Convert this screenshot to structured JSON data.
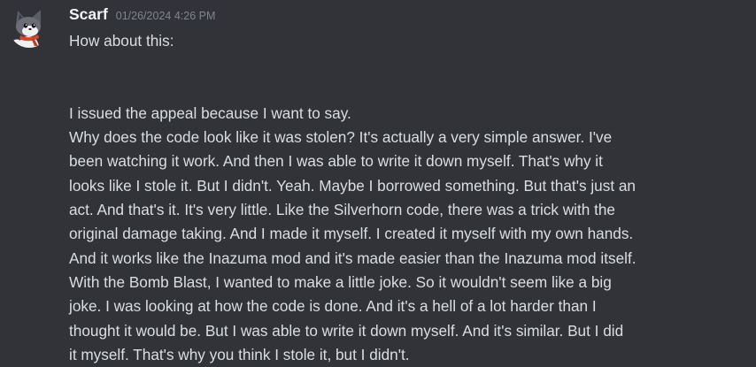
{
  "message": {
    "username": "Scarf",
    "timestamp": "01/26/2024 4:26 PM",
    "avatar_icon": "cartoon-cat-avatar-icon",
    "colors": {
      "background": "#313338",
      "username": "#f2f3f5",
      "timestamp": "#80848e",
      "text": "#dbdee1"
    },
    "lines": [
      "How about this:",
      "",
      "",
      "I issued the appeal because I want to say.",
      "Why does the code look like it was stolen? It's actually a very simple answer. I've",
      "been watching it work. And then I was able to write it down myself. That's why it",
      "looks like I stole it. But I didn't. Yeah. Maybe I borrowed something. But that's just an",
      "act. And that's it. It's very little. Like the Silverhorn code, there was a trick with the",
      "original damage taking. And I made it myself. I created it myself with my own hands.",
      "And it works like the Inazuma mod and it's made easier than the Inazuma mod itself.",
      "With the Bomb Blast, I wanted to make a little joke. So it wouldn't seem like a big",
      "joke. I was looking at how the code is done. And it's a hell of a lot harder than I",
      "thought it would be. But I was able to write it down myself. And it's similar. But I did",
      "it myself. That's why you think I stole it, but I didn't."
    ]
  }
}
